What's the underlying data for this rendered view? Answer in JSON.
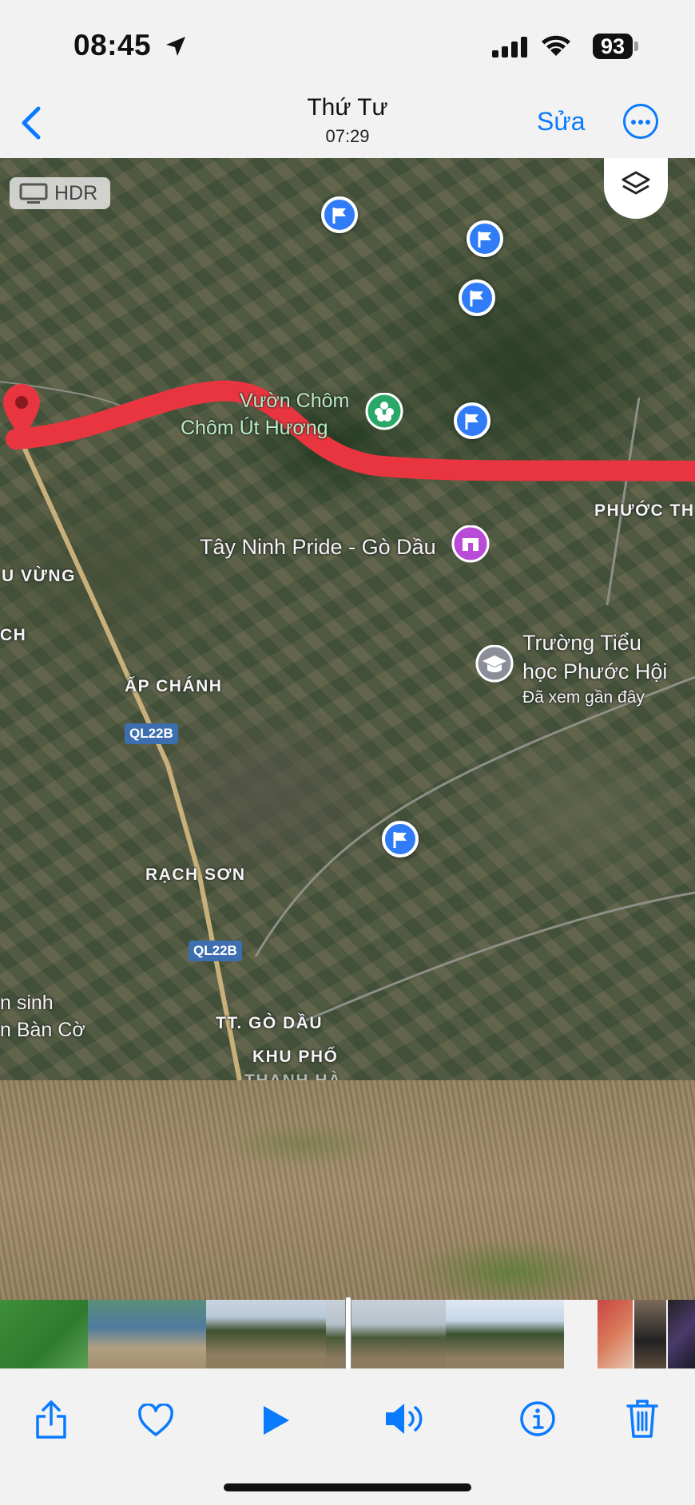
{
  "status_bar": {
    "time": "08:45",
    "battery": "93",
    "icons": [
      "location-arrow-icon",
      "cellular-signal-icon",
      "wifi-icon",
      "battery-icon"
    ]
  },
  "nav": {
    "title": "Thứ Tư",
    "subtitle": "07:29",
    "edit_label": "Sửa",
    "accent_color": "#0a7aff"
  },
  "photo": {
    "hdr_label": "HDR",
    "map_labels": {
      "poi_garden_line1": "Vườn Chôm",
      "poi_garden_line2": "Chôm Út Hương",
      "pride": "Tây Ninh Pride - Gò Dầu",
      "school_line1": "Trường Tiểu",
      "school_line2": "học Phước Hội",
      "school_note": "Đã xem gần đây",
      "phuoc_thanh": "PHƯỚC THẠNH",
      "u_vung": "U VỪNG",
      "ch": "CH",
      "ap_chanh": "ẤP CHÁNH",
      "road_1": "QL22B",
      "road_2": "QL22B",
      "rach_son": "RẠCH SƠN",
      "sinh_line1": "n sinh",
      "sinh_line2": "n Bàn Cờ",
      "tt_go_dau": "TT. GÒ DẦU",
      "khu_pho_line1": "KHU PHỐ",
      "khu_pho_line2": "THANH HÀ"
    },
    "route_color": "#e8353f"
  },
  "toolbar": {
    "buttons": [
      "share-icon",
      "heart-icon",
      "play-icon",
      "volume-icon",
      "info-icon",
      "trash-icon"
    ]
  }
}
